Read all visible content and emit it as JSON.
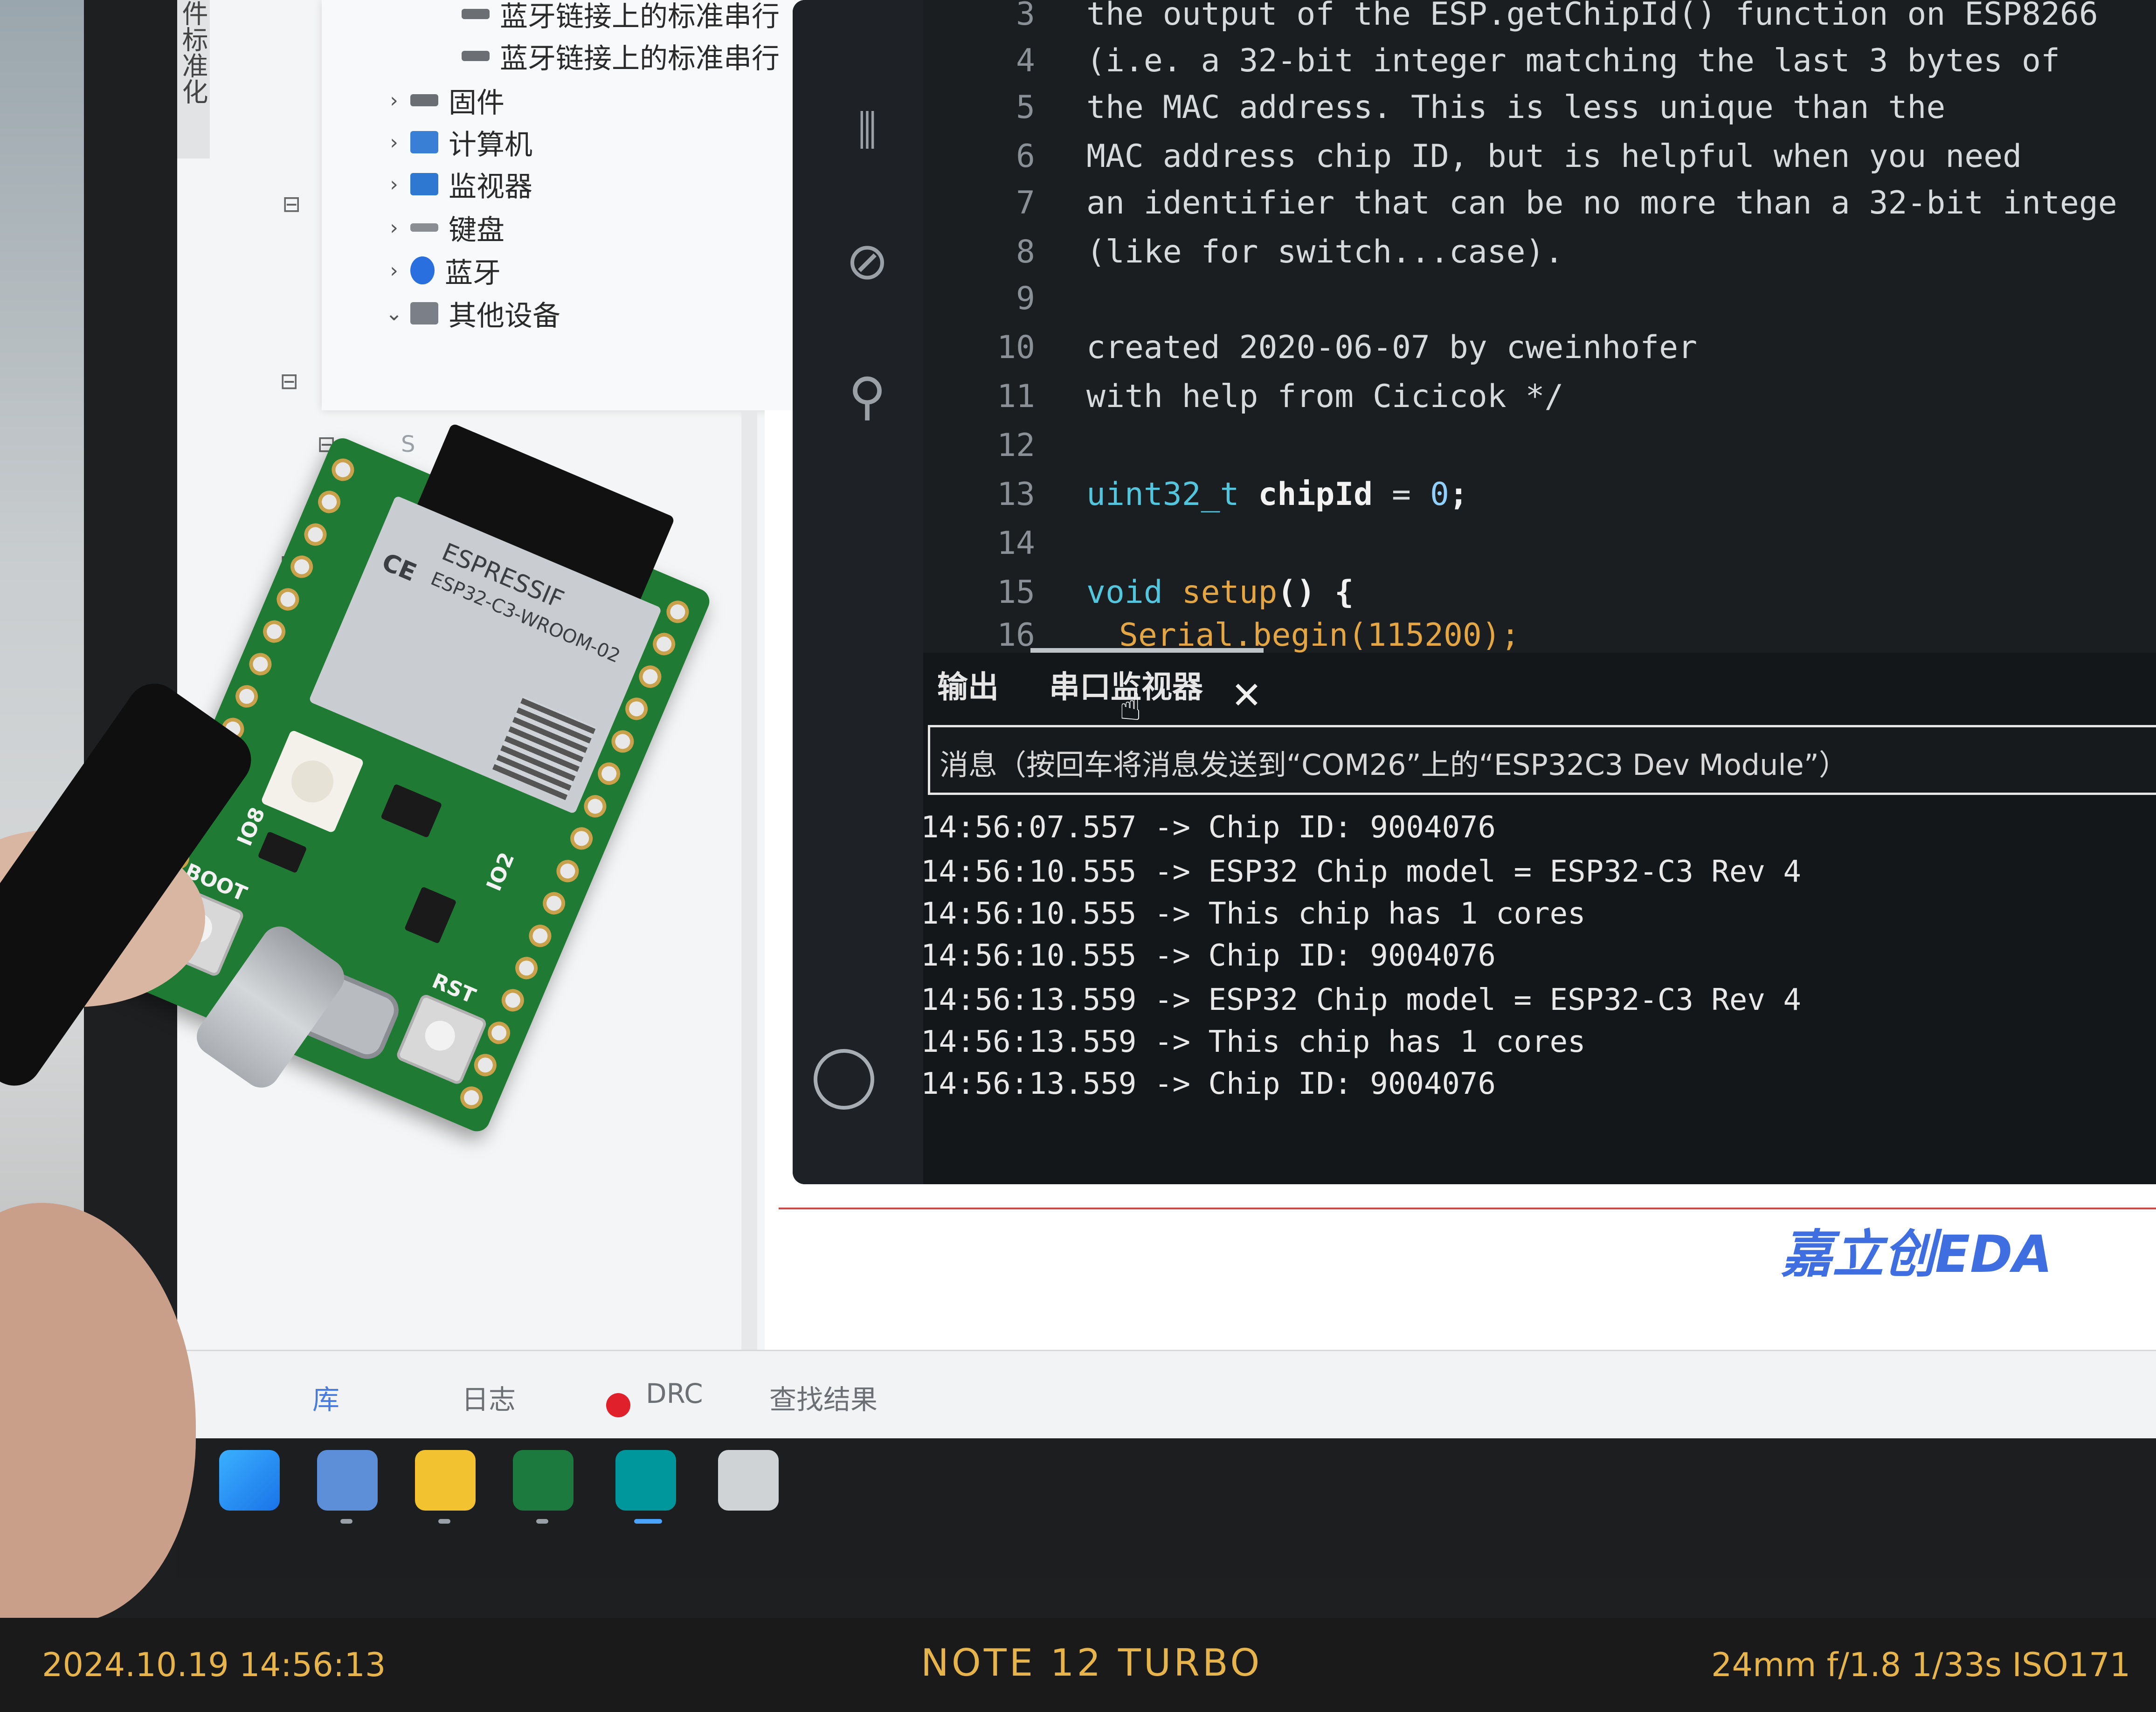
{
  "device_manager": {
    "vertical_label": "件标准化",
    "items": [
      {
        "label": "蓝牙链接上的标准串行",
        "expanded": false
      },
      {
        "label": "蓝牙链接上的标准串行",
        "expanded": false
      },
      {
        "label": "固件",
        "expanded": false
      },
      {
        "label": "计算机",
        "expanded": false
      },
      {
        "label": "监视器",
        "expanded": false
      },
      {
        "label": "键盘",
        "expanded": false
      },
      {
        "label": "蓝牙",
        "expanded": false
      },
      {
        "label": "其他设备",
        "expanded": true
      }
    ],
    "partial_label": "S"
  },
  "editor": {
    "lines": [
      {
        "n": "3",
        "text": "the output of the ESP.getChipId() function on ESP8266"
      },
      {
        "n": "4",
        "text": "(i.e. a 32-bit integer matching the last 3 bytes of"
      },
      {
        "n": "5",
        "text": "the MAC address. This is less unique than the"
      },
      {
        "n": "6",
        "text": "MAC address chip ID, but is helpful when you need"
      },
      {
        "n": "7",
        "text": "an identifier that can be no more than a 32-bit intege"
      },
      {
        "n": "8",
        "text": "(like for switch...case)."
      },
      {
        "n": "9",
        "text": ""
      },
      {
        "n": "10",
        "text": "created 2020-06-07 by cweinhofer"
      },
      {
        "n": "11",
        "text": "with help from Cicicok */"
      },
      {
        "n": "12",
        "text": ""
      }
    ],
    "line13": {
      "n": "13",
      "type": "uint32_t",
      "name": "chipId",
      "rest": " = ",
      "value": "0",
      "end": ";"
    },
    "line14": {
      "n": "14"
    },
    "line15": {
      "n": "15",
      "kw": "void",
      "fn": "setup",
      "rest": "() {"
    },
    "line16": {
      "n": "16",
      "text": "Serial.begin(115200);"
    }
  },
  "panel": {
    "tab_output": "输出",
    "tab_serial": "串口监视器",
    "close": "✕",
    "message_placeholder": "消息（按回车将消息发送到“COM26”上的“ESP32C3 Dev Module”）",
    "log": [
      "14:56:07.557 -> Chip ID: 9004076",
      "14:56:10.555 -> ESP32 Chip model = ESP32-C3 Rev 4",
      "14:56:10.555 -> This chip has 1 cores",
      "14:56:10.555 -> Chip ID: 9004076",
      "14:56:13.559 -> ESP32 Chip model = ESP32-C3 Rev 4",
      "14:56:13.559 -> This chip has 1 cores",
      "14:56:13.559 -> Chip ID: 9004076"
    ]
  },
  "eda": {
    "logo": "嘉立创EDA"
  },
  "bottom_tabs": {
    "library": "库",
    "log": "日志",
    "drc": "DRC",
    "search_results": "查找结果"
  },
  "board": {
    "brand": "ESPRESSIF",
    "model": "ESP32-C3-WROOM-02",
    "ce": "CE",
    "silk_boot": "BOOT",
    "silk_rst": "RST",
    "silk_io8": "IO8",
    "silk_io2": "IO2"
  },
  "camera": {
    "datetime": "2024.10.19  14:56:13",
    "model": "NOTE 12 TURBO",
    "exif": "24mm  f/1.8  1/33s  ISO171"
  },
  "colors": {
    "accent_blue": "#4a7be0",
    "watermark": "#e6b44b",
    "pcb_green": "#1f7a34",
    "drc_red": "#e0202a"
  }
}
